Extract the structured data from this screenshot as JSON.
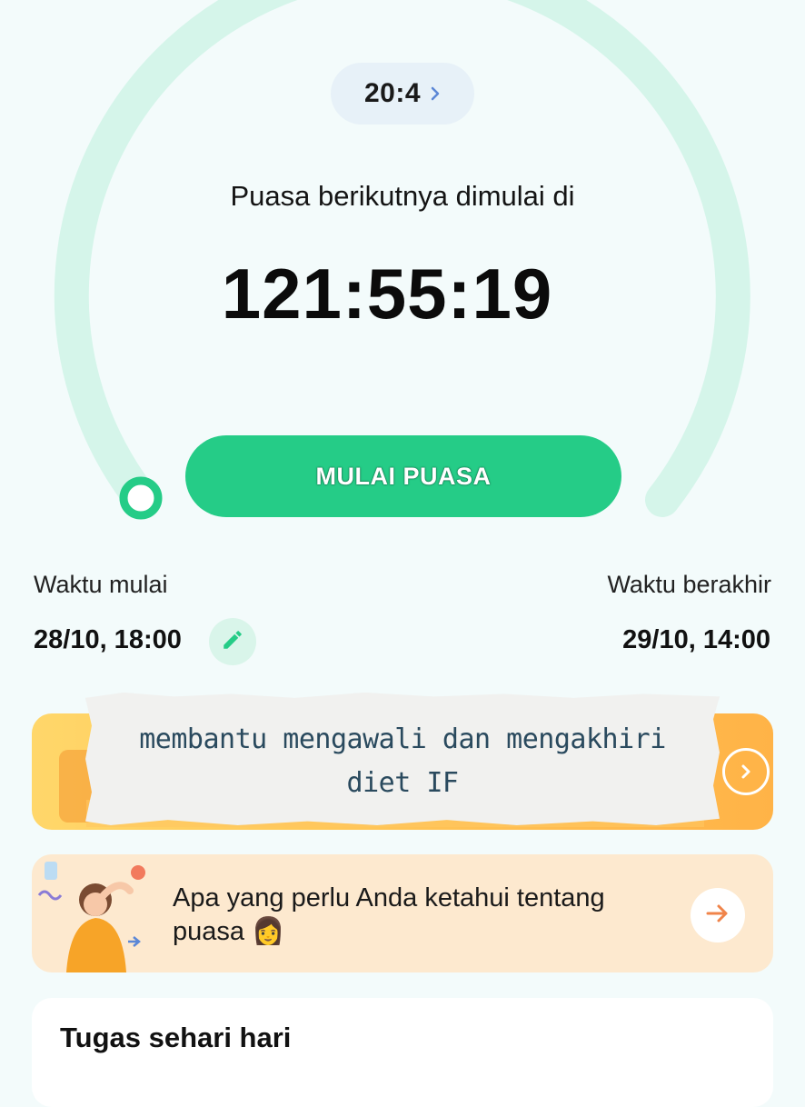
{
  "colors": {
    "background": "#f3fbfb",
    "ring_track": "#d5f5ea",
    "accent_green": "#25cc87",
    "pill_bg": "#e7f1f8",
    "promo_orange": "#ffc95a",
    "info_card_bg": "#fde9cf",
    "arrow_orange": "#f0844a"
  },
  "timer": {
    "plan_label": "20:4",
    "next_fast_label": "Puasa berikutnya dimulai di",
    "countdown": "121:55:19",
    "start_button": "MULAI PUASA"
  },
  "schedule": {
    "start_label": "Waktu mulai",
    "start_value": "28/10, 18:00",
    "end_label": "Waktu berakhir",
    "end_value": "29/10, 14:00"
  },
  "overlay_note": {
    "line1": "membantu mengawali dan mengakhiri",
    "line2": "diet IF"
  },
  "info_card": {
    "line1": "Apa yang perlu Anda ketahui tentang",
    "line2": "puasa 👩"
  },
  "tasks": {
    "title": "Tugas sehari hari"
  },
  "icons": {
    "plan_chevron": "chevron-right-icon",
    "edit": "pencil-icon",
    "promo_arrow": "arrow-right-circle-icon",
    "info_arrow": "arrow-right-icon",
    "illustration": "woman-illustration"
  }
}
